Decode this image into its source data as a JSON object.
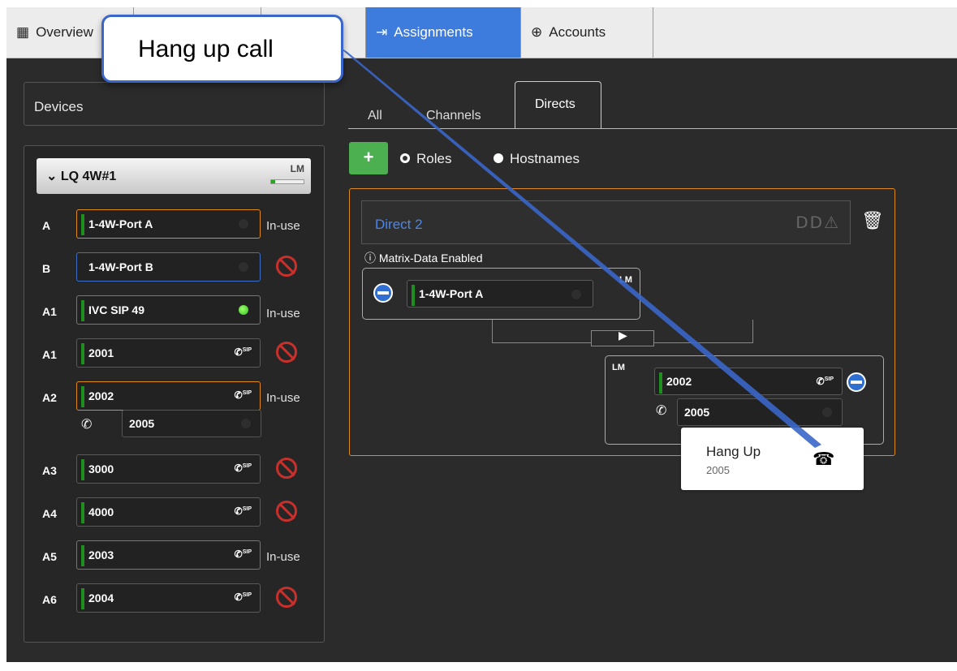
{
  "top_tabs": [
    {
      "label": "Overview",
      "icon": "grid-icon"
    },
    {
      "label": "",
      "icon": ""
    },
    {
      "label": "",
      "icon": ""
    },
    {
      "label": "Assignments",
      "icon": "assignments-icon"
    },
    {
      "label": "Accounts",
      "icon": "accounts-icon"
    }
  ],
  "left": {
    "devices_label": "Devices",
    "group": {
      "title": "LQ 4W#1",
      "lm": "LM"
    },
    "rows": [
      {
        "role": "A",
        "name": "1-4W-Port A",
        "status": "In-use"
      },
      {
        "role": "B",
        "name": "1-4W-Port B",
        "status": ""
      },
      {
        "role": "A1",
        "name": "IVC SIP 49",
        "status": "In-use"
      },
      {
        "role": "A1",
        "name": "2001",
        "status": "",
        "sip": "SIP"
      },
      {
        "role": "A2",
        "name": "2002",
        "status": "In-use",
        "sip": "SIP",
        "sub": "2005"
      },
      {
        "role": "A3",
        "name": "3000",
        "status": "",
        "sip": "SIP"
      },
      {
        "role": "A4",
        "name": "4000",
        "status": "",
        "sip": "SIP"
      },
      {
        "role": "A5",
        "name": "2003",
        "status": "In-use",
        "sip": "SIP"
      },
      {
        "role": "A6",
        "name": "2004",
        "status": "",
        "sip": "SIP"
      }
    ]
  },
  "right": {
    "subtabs": [
      "All",
      "Channels",
      "Directs"
    ],
    "radios": [
      "Roles",
      "Hostnames"
    ],
    "add_label": "+",
    "direct": {
      "title": "Direct 2",
      "matrix_label": "Matrix-Data Enabled",
      "source": {
        "name": "1-4W-Port A",
        "lm": "LM"
      },
      "target": {
        "name": "2002",
        "sub": "2005",
        "lm": "LM",
        "sip": "SIP"
      }
    }
  },
  "tooltip": {
    "title": "Hang Up",
    "subtitle": "2005"
  },
  "callout": {
    "text": "Hang up call"
  },
  "colors": {
    "accent": "#3d7bdc",
    "in_use_border": "#e08a1e",
    "green": "#1e8f1e",
    "danger": "#c9302c"
  }
}
